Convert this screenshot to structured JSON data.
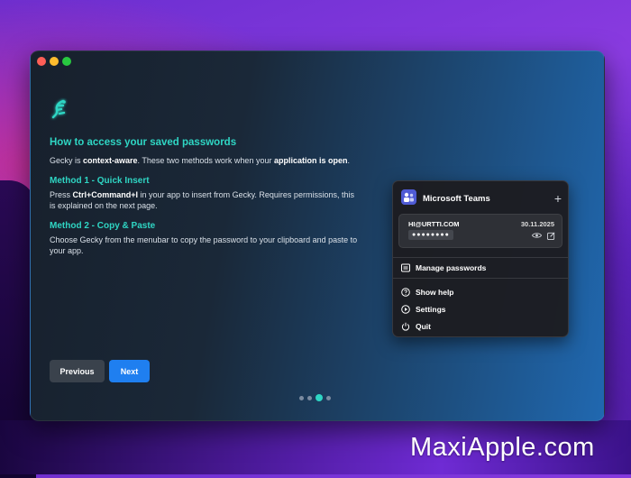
{
  "window": {
    "title_heading": "How to access your saved passwords",
    "intro_prefix": "Gecky is ",
    "intro_bold1": "context-aware",
    "intro_mid": ". These two methods work when your ",
    "intro_bold2": "application is open",
    "intro_suffix": ".",
    "method1_heading": "Method 1 - Quick Insert",
    "method1_prefix": "Press ",
    "method1_bold": "Ctrl+Command+I",
    "method1_suffix": " in your app to insert from Gecky. Requires permissions, this is explained on the next page.",
    "method2_heading": "Method 2 - Copy & Paste",
    "method2_text": "Choose Gecky from the menubar to copy the password to your clipboard and paste to your app.",
    "previous_label": "Previous",
    "next_label": "Next",
    "pagination": {
      "pages": 4,
      "current": 3
    }
  },
  "menu": {
    "app_name": "Microsoft Teams",
    "plus_label": "+",
    "card": {
      "user": "HI@URTTI.COM",
      "date": "30.11.2025",
      "password_mask": "●●●●●●●●"
    },
    "items": [
      {
        "label": "Manage passwords",
        "icon": "list-icon"
      },
      {
        "label": "Show help",
        "icon": "help-icon"
      },
      {
        "label": "Settings",
        "icon": "settings-icon"
      },
      {
        "label": "Quit",
        "icon": "power-icon"
      }
    ]
  },
  "watermark": "MaxiApple.com",
  "colors": {
    "accent": "#2fd6c4",
    "next_button": "#1f7ff0"
  }
}
